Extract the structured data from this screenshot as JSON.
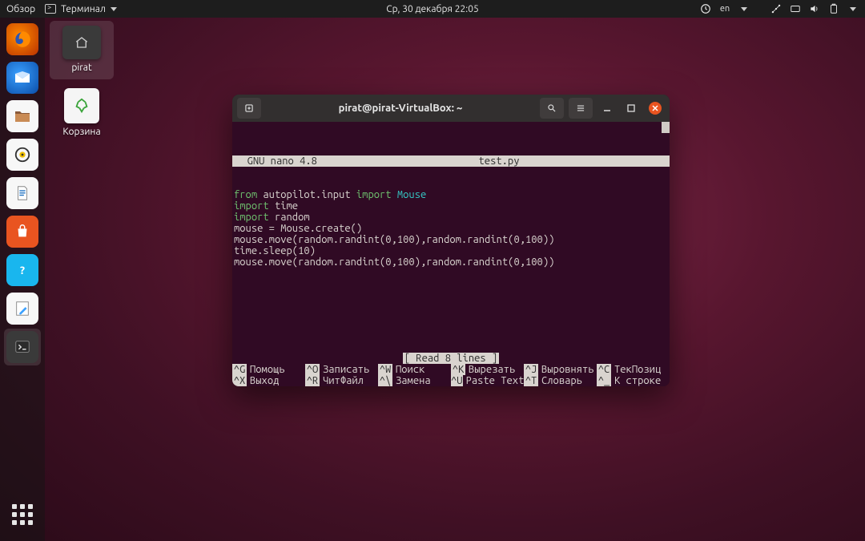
{
  "top_panel": {
    "overview": "Обзор",
    "active_app": "Терминал",
    "datetime": "Ср, 30 декабря  22:05",
    "lang": "en",
    "tray_icons": [
      "keyboard-status-icon",
      "lang-indicator",
      "caret-icon",
      "network-icon",
      "vpn-icon",
      "volume-icon",
      "battery-icon",
      "caret-icon"
    ]
  },
  "desktop": {
    "home_folder_label": "pirat",
    "trash_label": "Корзина"
  },
  "dock": {
    "items": [
      {
        "name": "firefox",
        "tooltip": "Firefox"
      },
      {
        "name": "thunderbird",
        "tooltip": "Thunderbird"
      },
      {
        "name": "files",
        "tooltip": "Files"
      },
      {
        "name": "rhythmbox",
        "tooltip": "Rhythmbox"
      },
      {
        "name": "libreoffice-writer",
        "tooltip": "LibreOffice Writer"
      },
      {
        "name": "software",
        "tooltip": "Ubuntu Software"
      },
      {
        "name": "help",
        "tooltip": "Help"
      },
      {
        "name": "text-editor",
        "tooltip": "Text Editor"
      },
      {
        "name": "terminal",
        "tooltip": "Terminal",
        "active": true
      }
    ],
    "apps_label": "Показать приложения"
  },
  "terminal": {
    "title": "pirat@pirat-VirtualBox: ~",
    "nano": {
      "banner_left": "  GNU nano 4.8",
      "banner_filename": "test.py",
      "status_msg": "[ Read 8 lines ]",
      "code": [
        [
          [
            "kw",
            "from"
          ],
          [
            "plain",
            " autopilot.input "
          ],
          [
            "kw",
            "import"
          ],
          [
            "name",
            " Mouse"
          ]
        ],
        [
          [
            "kw",
            "import"
          ],
          [
            "plain",
            " time"
          ]
        ],
        [
          [
            "kw",
            "import"
          ],
          [
            "plain",
            " random"
          ]
        ],
        [
          [
            "plain",
            "mouse = Mouse.create()"
          ]
        ],
        [
          [
            "plain",
            "mouse.move(random.randint(0,100),random.randint(0,100))"
          ]
        ],
        [
          [
            "plain",
            "time.sleep(10)"
          ]
        ],
        [
          [
            "plain",
            "mouse.move(random.randint(0,100),random.randint(0,100))"
          ]
        ]
      ],
      "help": [
        {
          "key": "^G",
          "label": "Помощь"
        },
        {
          "key": "^X",
          "label": "Выход"
        },
        {
          "key": "^O",
          "label": "Записать"
        },
        {
          "key": "^R",
          "label": "ЧитФайл"
        },
        {
          "key": "^W",
          "label": "Поиск"
        },
        {
          "key": "^\\",
          "label": "Замена"
        },
        {
          "key": "^K",
          "label": "Вырезать"
        },
        {
          "key": "^U",
          "label": "Paste Text"
        },
        {
          "key": "^J",
          "label": "Выровнять"
        },
        {
          "key": "^T",
          "label": "Словарь"
        },
        {
          "key": "^C",
          "label": "ТекПозиц"
        },
        {
          "key": "^_",
          "label": "К строке"
        }
      ]
    }
  }
}
